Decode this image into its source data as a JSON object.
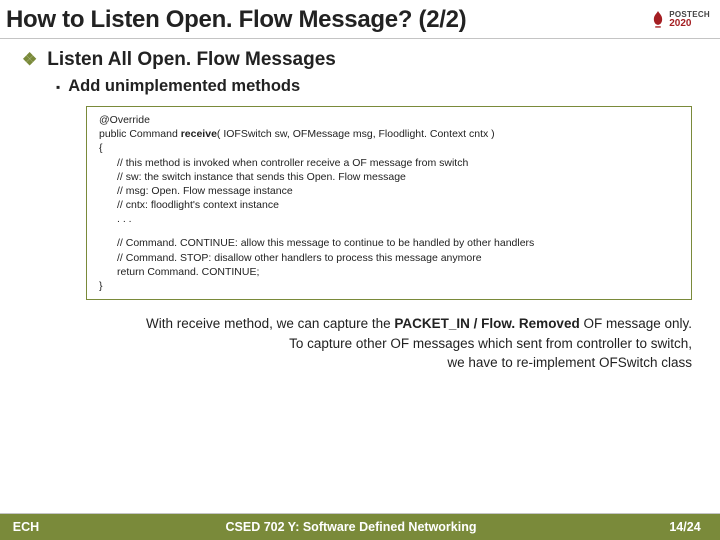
{
  "header": {
    "title": "How to Listen Open. Flow Message? (2/2)",
    "logo": {
      "top": "POSTECH",
      "bottom": "2020"
    }
  },
  "heading": "Listen All Open. Flow Messages",
  "subheading": "Add unimplemented methods",
  "code": {
    "l1": "@Override",
    "l2a": "public Command ",
    "l2b": "receive",
    "l2c": "( IOFSwitch sw, OFMessage msg, Floodlight. Context cntx )",
    "l3": "{",
    "l4": "// this method is invoked when controller receive a OF message from switch",
    "l5": "// sw: the switch instance that sends this Open. Flow message",
    "l6": "// msg: Open. Flow message instance",
    "l7": "// cntx: floodlight's context instance",
    "l8": ". . .",
    "l9": "// Command. CONTINUE: allow this message to continue to be handled by other handlers",
    "l10": "// Command. STOP: disallow other handlers to process this message anymore",
    "l11": "return Command. CONTINUE;",
    "l12": "}"
  },
  "notes": {
    "n1a": "With receive method, we can capture the ",
    "n1b": "PACKET_IN / Flow. Removed",
    "n1c": " OF message only.",
    "n2": "To capture other OF messages which sent from controller to switch,",
    "n3": "we have to re-implement OFSwitch class"
  },
  "footer": {
    "left": "ECH",
    "center": "CSED 702 Y: Software Defined Networking",
    "right": "14/24"
  }
}
